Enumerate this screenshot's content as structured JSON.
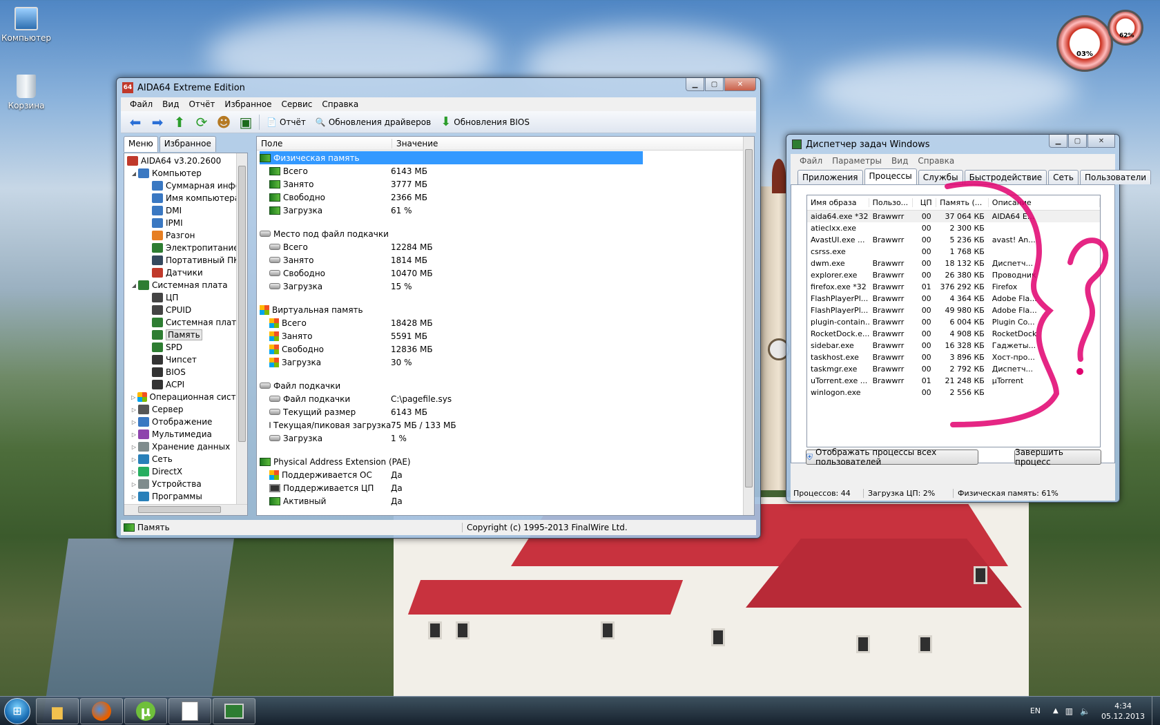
{
  "desktop": {
    "icons": [
      {
        "label": "Компьютер"
      },
      {
        "label": "Корзина"
      }
    ],
    "gadget": {
      "cpu_value": "03%",
      "mem_value": "62%"
    }
  },
  "aida": {
    "title": "AIDA64 Extreme Edition",
    "app_icon_text": "64",
    "menu": [
      "Файл",
      "Вид",
      "Отчёт",
      "Избранное",
      "Сервис",
      "Справка"
    ],
    "toolbar": {
      "report": "Отчёт",
      "driver_updates": "Обновления драйверов",
      "bios_updates": "Обновления BIOS"
    },
    "side_tabs": [
      "Меню",
      "Избранное"
    ],
    "tree": [
      {
        "label": "AIDA64 v3.20.2600",
        "level": 0,
        "icon": "aida-icon"
      },
      {
        "label": "Компьютер",
        "level": 1,
        "icon": "computer-icon",
        "exp": "◢"
      },
      {
        "label": "Суммарная инфор",
        "level": 2,
        "icon": "monitor-icon"
      },
      {
        "label": "Имя компьютера",
        "level": 2,
        "icon": "monitor-icon"
      },
      {
        "label": "DMI",
        "level": 2,
        "icon": "monitor-icon"
      },
      {
        "label": "IPMI",
        "level": 2,
        "icon": "monitor-icon"
      },
      {
        "label": "Разгон",
        "level": 2,
        "icon": "fire-icon"
      },
      {
        "label": "Электропитание",
        "level": 2,
        "icon": "power-icon"
      },
      {
        "label": "Портативный ПК",
        "level": 2,
        "icon": "laptop-icon"
      },
      {
        "label": "Датчики",
        "level": 2,
        "icon": "sensor-icon"
      },
      {
        "label": "Системная плата",
        "level": 1,
        "icon": "motherboard-icon",
        "exp": "◢"
      },
      {
        "label": "ЦП",
        "level": 2,
        "icon": "cpu-icon"
      },
      {
        "label": "CPUID",
        "level": 2,
        "icon": "cpu-icon"
      },
      {
        "label": "Системная плата",
        "level": 2,
        "icon": "motherboard-icon"
      },
      {
        "label": "Память",
        "level": 2,
        "icon": "ram-icon",
        "selected": true
      },
      {
        "label": "SPD",
        "level": 2,
        "icon": "ram-icon"
      },
      {
        "label": "Чипсет",
        "level": 2,
        "icon": "chip-icon"
      },
      {
        "label": "BIOS",
        "level": 2,
        "icon": "chip-icon"
      },
      {
        "label": "ACPI",
        "level": 2,
        "icon": "chip-icon"
      },
      {
        "label": "Операционная систем",
        "level": 1,
        "icon": "windows-icon",
        "exp": "▷"
      },
      {
        "label": "Сервер",
        "level": 1,
        "icon": "server-icon",
        "exp": "▷"
      },
      {
        "label": "Отображение",
        "level": 1,
        "icon": "display-icon",
        "exp": "▷"
      },
      {
        "label": "Мультимедиа",
        "level": 1,
        "icon": "multimedia-icon",
        "exp": "▷"
      },
      {
        "label": "Хранение данных",
        "level": 1,
        "icon": "storage-icon",
        "exp": "▷"
      },
      {
        "label": "Сеть",
        "level": 1,
        "icon": "network-icon",
        "exp": "▷"
      },
      {
        "label": "DirectX",
        "level": 1,
        "icon": "directx-icon",
        "exp": "▷"
      },
      {
        "label": "Устройства",
        "level": 1,
        "icon": "devices-icon",
        "exp": "▷"
      },
      {
        "label": "Программы",
        "level": 1,
        "icon": "programs-icon",
        "exp": "▷"
      }
    ],
    "columns": {
      "field": "Поле",
      "value": "Значение"
    },
    "sections": [
      {
        "title": "Физическая память",
        "icon": "ram",
        "selected": true,
        "rows": [
          {
            "k": "Всего",
            "v": "6143 МБ",
            "icon": "ram"
          },
          {
            "k": "Занято",
            "v": "3777 МБ",
            "icon": "ram"
          },
          {
            "k": "Свободно",
            "v": "2366 МБ",
            "icon": "ram"
          },
          {
            "k": "Загрузка",
            "v": "61 %",
            "icon": "ram"
          }
        ]
      },
      {
        "title": "Место под файл подкачки",
        "icon": "hdd",
        "rows": [
          {
            "k": "Всего",
            "v": "12284 МБ",
            "icon": "hdd"
          },
          {
            "k": "Занято",
            "v": "1814 МБ",
            "icon": "hdd"
          },
          {
            "k": "Свободно",
            "v": "10470 МБ",
            "icon": "hdd"
          },
          {
            "k": "Загрузка",
            "v": "15 %",
            "icon": "hdd"
          }
        ]
      },
      {
        "title": "Виртуальная память",
        "icon": "win",
        "rows": [
          {
            "k": "Всего",
            "v": "18428 МБ",
            "icon": "win"
          },
          {
            "k": "Занято",
            "v": "5591 МБ",
            "icon": "win"
          },
          {
            "k": "Свободно",
            "v": "12836 МБ",
            "icon": "win"
          },
          {
            "k": "Загрузка",
            "v": "30 %",
            "icon": "win"
          }
        ]
      },
      {
        "title": "Файл подкачки",
        "icon": "hdd",
        "rows": [
          {
            "k": "Файл подкачки",
            "v": "C:\\pagefile.sys",
            "icon": "hdd"
          },
          {
            "k": "Текущий размер",
            "v": "6143 МБ",
            "icon": "hdd"
          },
          {
            "k": "Текущая/пиковая загрузка",
            "v": "75 МБ / 133 МБ",
            "icon": "hdd"
          },
          {
            "k": "Загрузка",
            "v": "1 %",
            "icon": "hdd"
          }
        ]
      },
      {
        "title": "Physical Address Extension (PAE)",
        "icon": "ram",
        "rows": [
          {
            "k": "Поддерживается ОС",
            "v": "Да",
            "icon": "win"
          },
          {
            "k": "Поддерживается ЦП",
            "v": "Да",
            "icon": "chip"
          },
          {
            "k": "Активный",
            "v": "Да",
            "icon": "ram"
          }
        ]
      }
    ],
    "status_left": "Память",
    "status_right": "Copyright (c) 1995-2013 FinalWire Ltd."
  },
  "taskmgr": {
    "title": "Диспетчер задач Windows",
    "menu": [
      "Файл",
      "Параметры",
      "Вид",
      "Справка"
    ],
    "tabs": [
      "Приложения",
      "Процессы",
      "Службы",
      "Быстродействие",
      "Сеть",
      "Пользователи"
    ],
    "active_tab": "Процессы",
    "columns": [
      "Имя образа",
      "Пользо...",
      "ЦП",
      "Память (...",
      "Описание"
    ],
    "rows": [
      [
        "aida64.exe *32",
        "Brawwrr",
        "00",
        "37 064 КБ",
        "AIDA64 E..."
      ],
      [
        "atieclxx.exe",
        "",
        "00",
        "2 300 КБ",
        ""
      ],
      [
        "AvastUI.exe ...",
        "Brawwrr",
        "00",
        "5 236 КБ",
        "avast! An..."
      ],
      [
        "csrss.exe",
        "",
        "00",
        "1 768 КБ",
        ""
      ],
      [
        "dwm.exe",
        "Brawwrr",
        "00",
        "18 132 КБ",
        "Диспетч..."
      ],
      [
        "explorer.exe",
        "Brawwrr",
        "00",
        "26 380 КБ",
        "Проводник"
      ],
      [
        "firefox.exe *32",
        "Brawwrr",
        "01",
        "376 292 КБ",
        "Firefox"
      ],
      [
        "FlashPlayerPl...",
        "Brawwrr",
        "00",
        "4 364 КБ",
        "Adobe Fla..."
      ],
      [
        "FlashPlayerPl...",
        "Brawwrr",
        "00",
        "49 980 КБ",
        "Adobe Fla..."
      ],
      [
        "plugin-contain...",
        "Brawwrr",
        "00",
        "6 004 КБ",
        "Plugin Co..."
      ],
      [
        "RocketDock.e...",
        "Brawwrr",
        "00",
        "4 908 КБ",
        "RocketDock"
      ],
      [
        "sidebar.exe",
        "Brawwrr",
        "00",
        "16 328 КБ",
        "Гаджеты..."
      ],
      [
        "taskhost.exe",
        "Brawwrr",
        "00",
        "3 896 КБ",
        "Хост-про..."
      ],
      [
        "taskmgr.exe",
        "Brawwrr",
        "00",
        "2 792 КБ",
        "Диспетч..."
      ],
      [
        "uTorrent.exe ...",
        "Brawwrr",
        "01",
        "21 248 КБ",
        "µTorrent"
      ],
      [
        "winlogon.exe",
        "",
        "00",
        "2 556 КБ",
        ""
      ]
    ],
    "show_all_button": "Отображать процессы всех пользователей",
    "end_process_button": "Завершить процесс",
    "status": {
      "processes": "Процессов: 44",
      "cpu": "Загрузка ЦП: 2%",
      "memory": "Физическая память: 61%"
    }
  },
  "taskbar": {
    "apps": [
      "explorer-icon",
      "firefox-icon",
      "utorrent-icon",
      "aida64-taskbar-icon",
      "taskmgr-taskbar-icon"
    ],
    "lang": "EN",
    "time": "4:34",
    "date": "05.12.2013"
  }
}
